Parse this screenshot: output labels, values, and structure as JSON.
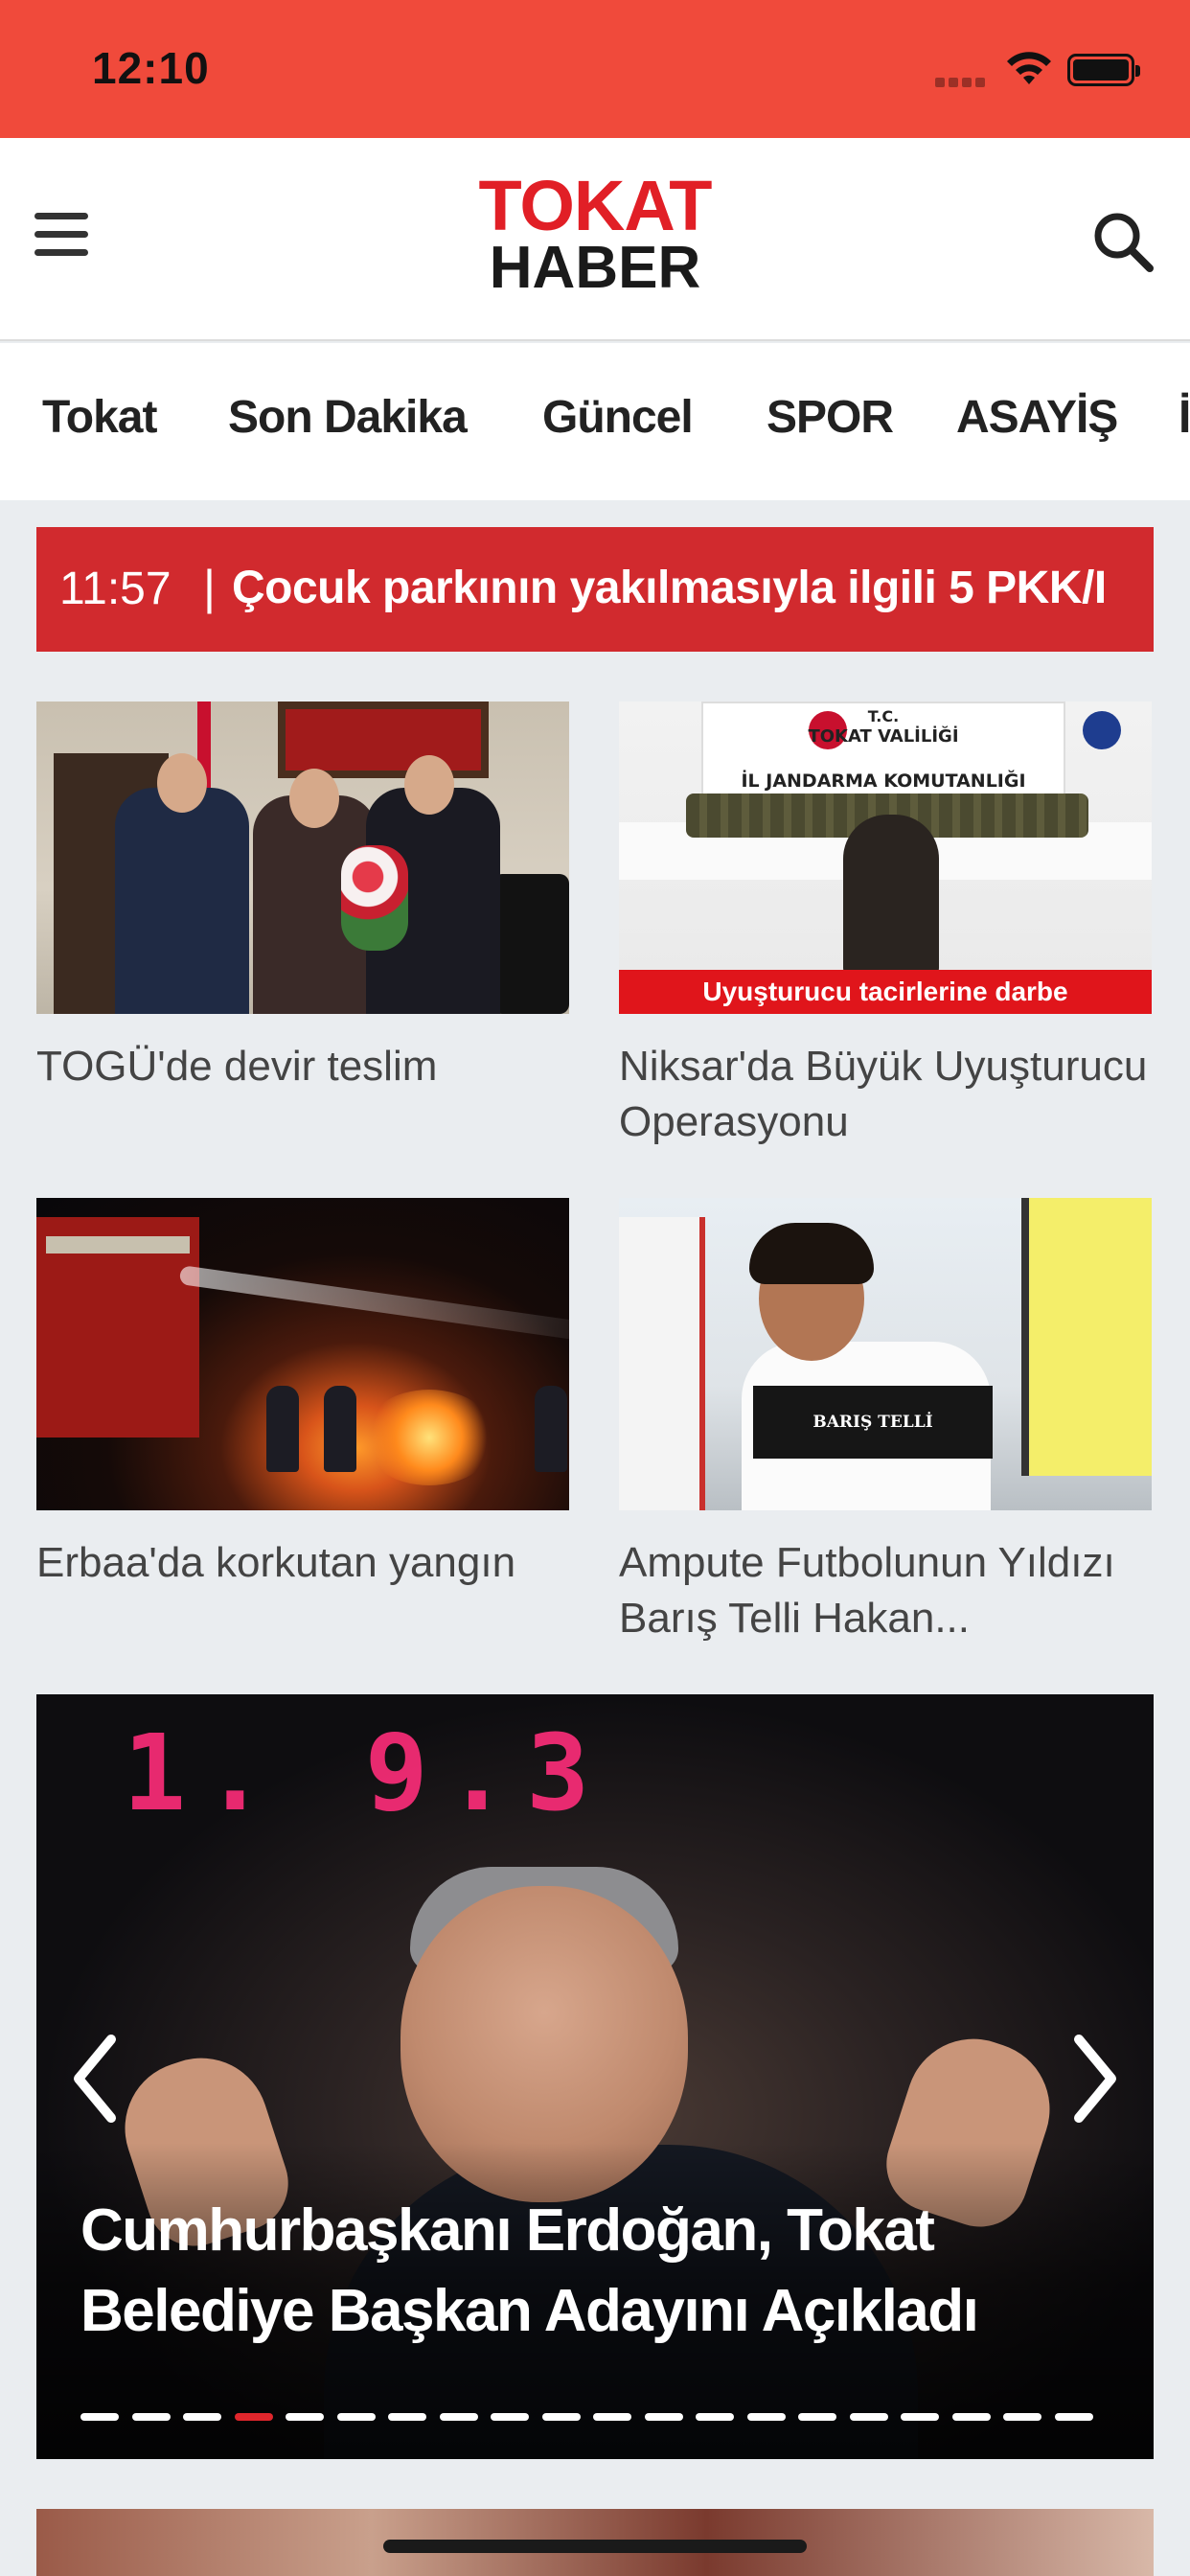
{
  "status_bar": {
    "time": "12:10"
  },
  "header": {
    "logo_top": "TOKAT",
    "logo_bottom": "HABER"
  },
  "categories": [
    {
      "label": "Tokat"
    },
    {
      "label": "Son Dakika"
    },
    {
      "label": "Güncel"
    },
    {
      "label": "SPOR"
    },
    {
      "label": "ASAYİŞ"
    },
    {
      "label": "İ"
    }
  ],
  "ticker": {
    "time": "11:57",
    "separator": "|",
    "headline": "Çocuk parkının yakılmasıyla ilgili 5 PKK/I"
  },
  "news": [
    {
      "title": "TOGÜ'de devir teslim"
    },
    {
      "title": "Niksar'da Büyük Uyuşturucu Operasyonu",
      "image_sign_line1": "T.C.",
      "image_sign_line2": "TOKAT VALİLİĞİ",
      "image_sign_line3": "İL JANDARMA KOMUTANLIĞI",
      "image_banner": "Uyuşturucu tacirlerine darbe"
    },
    {
      "title": "Erbaa'da korkutan yangın"
    },
    {
      "title": "Ampute Futbolunun Yıldızı Barış Telli Hakan...",
      "image_chair_text": "BARIŞ TELLİ"
    }
  ],
  "slider": {
    "display_text": "1. 9.3",
    "title": "Cumhurbaşkanı Erdoğan, Tokat Belediye Başkan Adayını Açıkladı",
    "dot_count": 20,
    "active_index": 3
  },
  "colors": {
    "status_bar_bg": "#f04a3b",
    "brand_red": "#e11f26",
    "ticker_bg": "#d12a2e",
    "active_dot": "#e0262c"
  }
}
